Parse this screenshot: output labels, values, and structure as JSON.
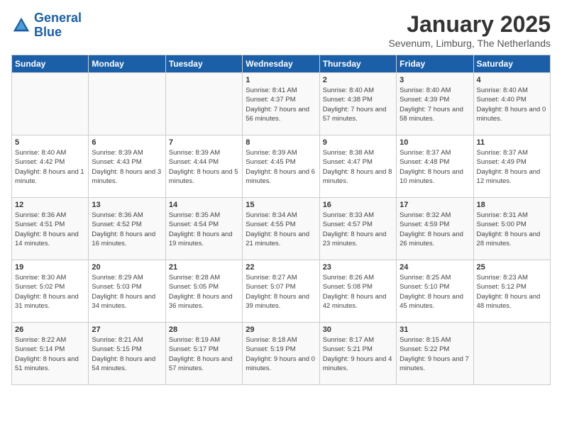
{
  "header": {
    "logo_line1": "General",
    "logo_line2": "Blue",
    "month": "January 2025",
    "location": "Sevenum, Limburg, The Netherlands"
  },
  "days_of_week": [
    "Sunday",
    "Monday",
    "Tuesday",
    "Wednesday",
    "Thursday",
    "Friday",
    "Saturday"
  ],
  "weeks": [
    [
      {
        "day": "",
        "info": ""
      },
      {
        "day": "",
        "info": ""
      },
      {
        "day": "",
        "info": ""
      },
      {
        "day": "1",
        "info": "Sunrise: 8:41 AM\nSunset: 4:37 PM\nDaylight: 7 hours and 56 minutes."
      },
      {
        "day": "2",
        "info": "Sunrise: 8:40 AM\nSunset: 4:38 PM\nDaylight: 7 hours and 57 minutes."
      },
      {
        "day": "3",
        "info": "Sunrise: 8:40 AM\nSunset: 4:39 PM\nDaylight: 7 hours and 58 minutes."
      },
      {
        "day": "4",
        "info": "Sunrise: 8:40 AM\nSunset: 4:40 PM\nDaylight: 8 hours and 0 minutes."
      }
    ],
    [
      {
        "day": "5",
        "info": "Sunrise: 8:40 AM\nSunset: 4:42 PM\nDaylight: 8 hours and 1 minute."
      },
      {
        "day": "6",
        "info": "Sunrise: 8:39 AM\nSunset: 4:43 PM\nDaylight: 8 hours and 3 minutes."
      },
      {
        "day": "7",
        "info": "Sunrise: 8:39 AM\nSunset: 4:44 PM\nDaylight: 8 hours and 5 minutes."
      },
      {
        "day": "8",
        "info": "Sunrise: 8:39 AM\nSunset: 4:45 PM\nDaylight: 8 hours and 6 minutes."
      },
      {
        "day": "9",
        "info": "Sunrise: 8:38 AM\nSunset: 4:47 PM\nDaylight: 8 hours and 8 minutes."
      },
      {
        "day": "10",
        "info": "Sunrise: 8:37 AM\nSunset: 4:48 PM\nDaylight: 8 hours and 10 minutes."
      },
      {
        "day": "11",
        "info": "Sunrise: 8:37 AM\nSunset: 4:49 PM\nDaylight: 8 hours and 12 minutes."
      }
    ],
    [
      {
        "day": "12",
        "info": "Sunrise: 8:36 AM\nSunset: 4:51 PM\nDaylight: 8 hours and 14 minutes."
      },
      {
        "day": "13",
        "info": "Sunrise: 8:36 AM\nSunset: 4:52 PM\nDaylight: 8 hours and 16 minutes."
      },
      {
        "day": "14",
        "info": "Sunrise: 8:35 AM\nSunset: 4:54 PM\nDaylight: 8 hours and 19 minutes."
      },
      {
        "day": "15",
        "info": "Sunrise: 8:34 AM\nSunset: 4:55 PM\nDaylight: 8 hours and 21 minutes."
      },
      {
        "day": "16",
        "info": "Sunrise: 8:33 AM\nSunset: 4:57 PM\nDaylight: 8 hours and 23 minutes."
      },
      {
        "day": "17",
        "info": "Sunrise: 8:32 AM\nSunset: 4:59 PM\nDaylight: 8 hours and 26 minutes."
      },
      {
        "day": "18",
        "info": "Sunrise: 8:31 AM\nSunset: 5:00 PM\nDaylight: 8 hours and 28 minutes."
      }
    ],
    [
      {
        "day": "19",
        "info": "Sunrise: 8:30 AM\nSunset: 5:02 PM\nDaylight: 8 hours and 31 minutes."
      },
      {
        "day": "20",
        "info": "Sunrise: 8:29 AM\nSunset: 5:03 PM\nDaylight: 8 hours and 34 minutes."
      },
      {
        "day": "21",
        "info": "Sunrise: 8:28 AM\nSunset: 5:05 PM\nDaylight: 8 hours and 36 minutes."
      },
      {
        "day": "22",
        "info": "Sunrise: 8:27 AM\nSunset: 5:07 PM\nDaylight: 8 hours and 39 minutes."
      },
      {
        "day": "23",
        "info": "Sunrise: 8:26 AM\nSunset: 5:08 PM\nDaylight: 8 hours and 42 minutes."
      },
      {
        "day": "24",
        "info": "Sunrise: 8:25 AM\nSunset: 5:10 PM\nDaylight: 8 hours and 45 minutes."
      },
      {
        "day": "25",
        "info": "Sunrise: 8:23 AM\nSunset: 5:12 PM\nDaylight: 8 hours and 48 minutes."
      }
    ],
    [
      {
        "day": "26",
        "info": "Sunrise: 8:22 AM\nSunset: 5:14 PM\nDaylight: 8 hours and 51 minutes."
      },
      {
        "day": "27",
        "info": "Sunrise: 8:21 AM\nSunset: 5:15 PM\nDaylight: 8 hours and 54 minutes."
      },
      {
        "day": "28",
        "info": "Sunrise: 8:19 AM\nSunset: 5:17 PM\nDaylight: 8 hours and 57 minutes."
      },
      {
        "day": "29",
        "info": "Sunrise: 8:18 AM\nSunset: 5:19 PM\nDaylight: 9 hours and 0 minutes."
      },
      {
        "day": "30",
        "info": "Sunrise: 8:17 AM\nSunset: 5:21 PM\nDaylight: 9 hours and 4 minutes."
      },
      {
        "day": "31",
        "info": "Sunrise: 8:15 AM\nSunset: 5:22 PM\nDaylight: 9 hours and 7 minutes."
      },
      {
        "day": "",
        "info": ""
      }
    ]
  ]
}
